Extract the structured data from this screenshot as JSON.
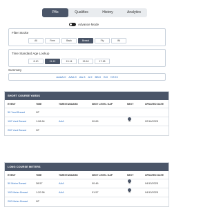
{
  "tabs": [
    {
      "label": "PBs"
    },
    {
      "label": "Qualifies"
    },
    {
      "label": "History"
    },
    {
      "label": "Analytics"
    }
  ],
  "advance_mode": {
    "label": "Advance Mode"
  },
  "filter_stroke": {
    "title": "Filter Stroke",
    "options": [
      "All",
      "Free",
      "Back",
      "Breast",
      "Fly",
      "IM"
    ],
    "selected": "Breast"
  },
  "age_lookup": {
    "title": "Time Standard Age Lookup",
    "options": [
      "8-10",
      "11-12",
      "13-14",
      "15-16",
      "17-18"
    ],
    "selected": "11-12"
  },
  "summary": {
    "title": "Summary",
    "items": [
      "AAAA:0",
      "AAA:9",
      "AA:3",
      "A:9",
      "BB:0",
      "B:0",
      "NT:23"
    ]
  },
  "short_course": {
    "title": "SHORT COURSE YARDS",
    "columns": [
      "EVENT",
      "TIME",
      "TIMESTANDARD",
      "NEXT LEVEL GAP",
      "NEXT",
      "UPDATED DATE"
    ],
    "rows": [
      {
        "event": "50 Yard Breast",
        "time": "NT",
        "standard": "",
        "gap": "",
        "next": "",
        "date": ""
      },
      {
        "event": "100 Yard Breast",
        "time": "1:08.64",
        "standard": "AAA",
        "gap": "00.65",
        "next": "S",
        "date": "02/16/2025"
      },
      {
        "event": "200 Yard Breast",
        "time": "NT",
        "standard": "",
        "gap": "",
        "next": "",
        "date": ""
      }
    ]
  },
  "long_course": {
    "title": "LONG COURSE METERS",
    "columns": [
      "EVENT",
      "TIME",
      "TIMESTANDARD",
      "NEXT LEVEL GAP",
      "NEXT",
      "UPDATED DATE"
    ],
    "rows": [
      {
        "event": "50 Meter Breast",
        "time": "38.57",
        "standard": "AAA",
        "gap": "00.46",
        "next": "S",
        "date": "04/13/2025"
      },
      {
        "event": "100 Meter Breast",
        "time": "1:20.56",
        "standard": "AAA",
        "gap": "01.57",
        "next": "S",
        "date": "04/13/2025"
      },
      {
        "event": "200 Meter Breast",
        "time": "NT",
        "standard": "",
        "gap": "",
        "next": "",
        "date": ""
      }
    ]
  },
  "colors": {
    "accent": "#4a5568",
    "link": "#2a6ec4",
    "border": "#c9d2dc"
  }
}
